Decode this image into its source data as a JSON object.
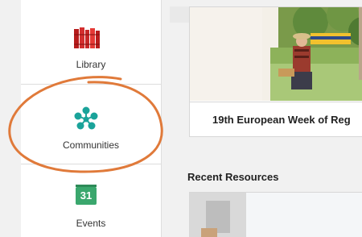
{
  "sidebar": {
    "items": [
      {
        "label": "Library",
        "icon": "library-books-icon"
      },
      {
        "label": "Communities",
        "icon": "communities-network-icon"
      },
      {
        "label": "Events",
        "icon": "calendar-icon",
        "badge": "31"
      }
    ]
  },
  "main": {
    "featured_card": {
      "caption": "19th European Week of Reg"
    },
    "recent_resources_title": "Recent Resources"
  },
  "colors": {
    "accent_teal": "#1aa39a",
    "events_green": "#3aa76d",
    "library_red": "#c62828",
    "highlight_orange": "#e07a3a"
  }
}
